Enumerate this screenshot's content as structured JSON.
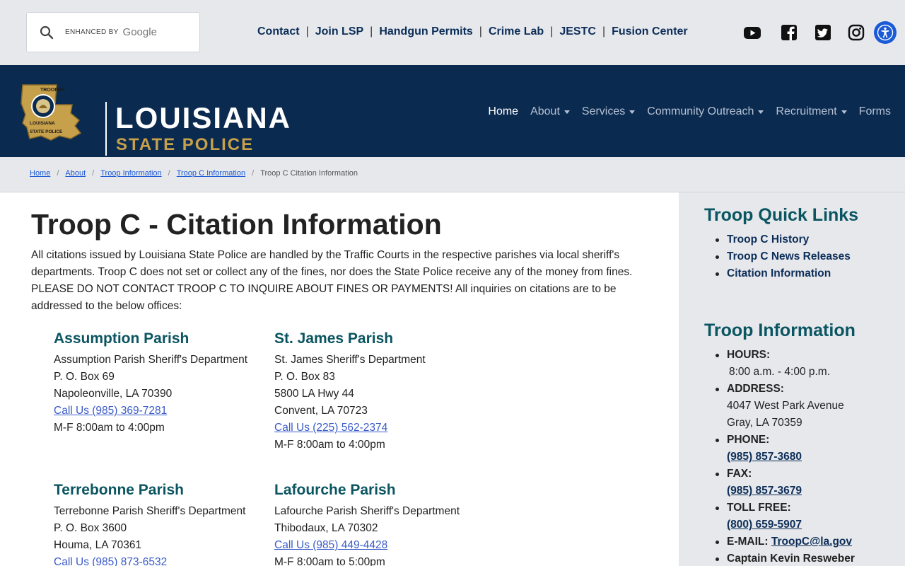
{
  "search": {
    "enhanced_label": "ENHANCED BY",
    "brand": "Google"
  },
  "utility_links": [
    "Contact",
    "Join LSP",
    "Handgun Permits",
    "Crime Lab",
    "JESTC",
    "Fusion Center"
  ],
  "utility_separator": "|",
  "social_icons": [
    "youtube-icon",
    "facebook-icon",
    "twitter-icon",
    "instagram-icon"
  ],
  "logo": {
    "title": "LOUISIANA",
    "subtitle": "STATE POLICE",
    "badge_top": "TROOPER",
    "badge_state": "LOUISIANA",
    "badge_bottom": "STATE   POLICE"
  },
  "nav": [
    {
      "label": "Home",
      "active": true,
      "dropdown": false
    },
    {
      "label": "About",
      "active": false,
      "dropdown": true
    },
    {
      "label": "Services",
      "active": false,
      "dropdown": true
    },
    {
      "label": "Community Outreach",
      "active": false,
      "dropdown": true
    },
    {
      "label": "Recruitment",
      "active": false,
      "dropdown": true
    },
    {
      "label": "Forms",
      "active": false,
      "dropdown": false
    }
  ],
  "breadcrumb": {
    "items": [
      "Home",
      "About",
      "Troop Information",
      "Troop C Information"
    ],
    "current": "Troop C Citation Information",
    "separator": "/"
  },
  "page": {
    "title": "Troop C - Citation Information",
    "intro": "All citations issued by Louisiana State Police are handled by the Traffic Courts in the respective parishes via local sheriff's departments. Troop C does not set or collect any of the fines, nor does the State Police receive any of the money from fines. PLEASE DO NOT CONTACT TROOP C TO INQUIRE ABOUT FINES OR PAYMENTS! All inquiries on citations are to be addressed to the below offices:"
  },
  "parishes": [
    {
      "name": "Assumption Parish",
      "lines": [
        "Assumption Parish Sheriff's Department",
        "P. O. Box 69",
        "Napoleonville, LA 70390"
      ],
      "phone": "Call Us (985) 369-7281",
      "hours": "M-F 8:00am to 4:00pm"
    },
    {
      "name": "St. James Parish",
      "lines": [
        "St. James Sheriff's Department",
        "P. O. Box 83",
        "5800 LA Hwy 44",
        "Convent, LA 70723"
      ],
      "phone": "Call Us (225) 562-2374",
      "hours": "M-F 8:00am to 4:00pm"
    },
    {
      "name": "Terrebonne Parish",
      "lines": [
        "Terrebonne Parish Sheriff's Department",
        "P. O. Box 3600",
        "Houma, LA 70361"
      ],
      "phone": "Call Us (985) 873-6532",
      "hours": ""
    },
    {
      "name": "Lafourche Parish",
      "lines": [
        "Lafourche Parish Sheriff's Department",
        "Thibodaux, LA 70302"
      ],
      "phone": "Call Us (985) 449-4428",
      "hours": "M-F 8:00am to 5:00pm"
    }
  ],
  "sidebar": {
    "quick_links_title": "Troop Quick Links",
    "quick_links": [
      "Troop C History",
      "Troop C News Releases",
      "Citation Information"
    ],
    "info_title": "Troop Information",
    "hours_label": "HOURS:",
    "hours_value": "8:00 a.m. - 4:00 p.m.",
    "address_label": "ADDRESS:",
    "address_line1": "4047 West Park Avenue",
    "address_line2": "Gray, LA 70359",
    "phone_label": "PHONE:",
    "phone_value": "(985) 857-3680",
    "fax_label": "FAX:",
    "fax_value": "(985) 857-3679",
    "tollfree_label": "TOLL FREE:",
    "tollfree_value": "(800) 659-5907",
    "email_label": "E-MAIL:",
    "email_value": "TroopC@la.gov",
    "captain": "Captain Kevin Resweber"
  },
  "colors": {
    "navy": "#0b2a4f",
    "teal_heading": "#0a5561",
    "gold": "#c6a04b",
    "link_blue": "#1a5ad7",
    "gray_bg": "#e6e8ec"
  }
}
